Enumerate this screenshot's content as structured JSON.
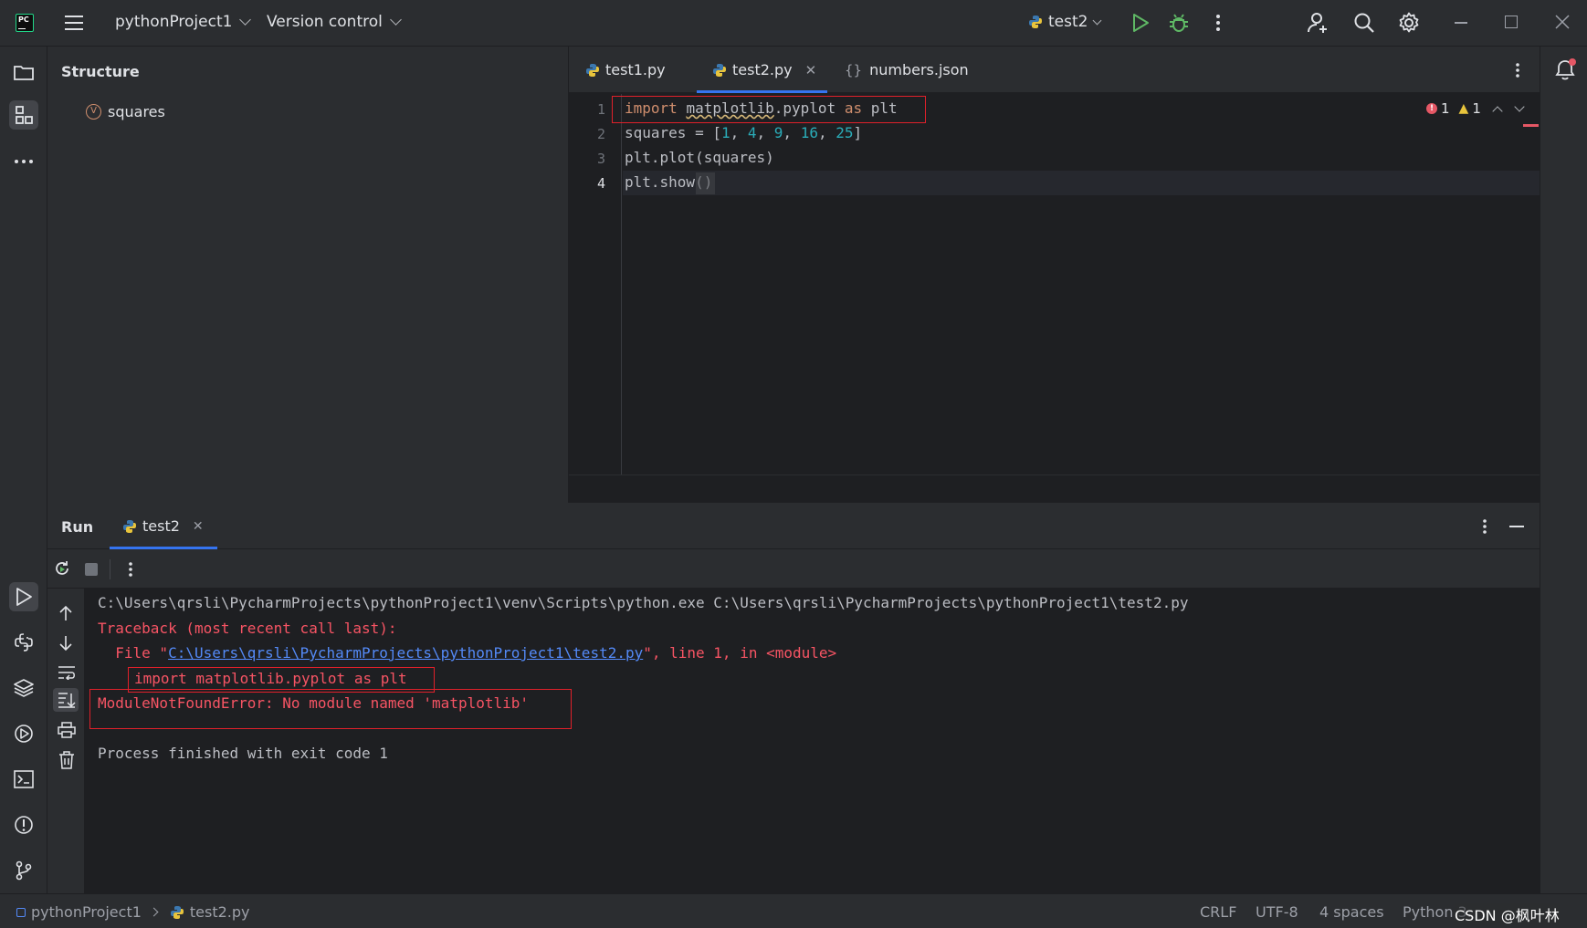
{
  "titlebar": {
    "logo": "PC",
    "project": "pythonProject1",
    "version_control": "Version control",
    "run_config": "test2"
  },
  "structure": {
    "title": "Structure",
    "item_badge": "V",
    "item_label": "squares"
  },
  "editor": {
    "tabs": [
      {
        "label": "test1.py",
        "icon": "python-icon"
      },
      {
        "label": "test2.py",
        "icon": "python-icon",
        "active": true
      },
      {
        "label": "numbers.json",
        "icon": "json-braces-icon"
      }
    ],
    "error_count": "1",
    "warning_count": "1",
    "line_numbers": [
      "1",
      "2",
      "3",
      "4"
    ],
    "code": [
      {
        "kw1": "import",
        "mod": "matplotlib",
        "rest": ".pyplot",
        "kw2": "as",
        "alias": "plt"
      },
      {
        "prefix": "squares = [",
        "nums": [
          "1",
          "4",
          "9",
          "16",
          "25"
        ],
        "suffix": "]"
      },
      {
        "text": "plt.plot(squares)"
      },
      {
        "text": "plt.show()"
      }
    ]
  },
  "run": {
    "title": "Run",
    "tab": "test2",
    "output": {
      "cmd": "C:\\Users\\qrsli\\PycharmProjects\\pythonProject1\\venv\\Scripts\\python.exe C:\\Users\\qrsli\\PycharmProjects\\pythonProject1\\test2.py",
      "traceback": "Traceback (most recent call last):",
      "file_prefix": "  File \"",
      "file_link": "C:\\Users\\qrsli\\PycharmProjects\\pythonProject1\\test2.py",
      "file_suffix": "\", line 1, in <module>",
      "import_line": "import matplotlib.pyplot as plt",
      "error": "ModuleNotFoundError: No module named 'matplotlib'",
      "finished": "Process finished with exit code 1"
    }
  },
  "statusbar": {
    "project": "pythonProject1",
    "file": "test2.py",
    "line_sep": "CRLF",
    "encoding": "UTF-8",
    "indent": "4 spaces",
    "interpreter": "Python 3.",
    "watermark": "CSDN @枫叶林"
  },
  "colors": {
    "bg": "#1e1f22",
    "panel": "#2b2d30",
    "error_red": "#f75464",
    "keyword": "#cf8e6d",
    "number": "#2aacb8",
    "link": "#548af7",
    "highlight_box": "#e0202a"
  }
}
